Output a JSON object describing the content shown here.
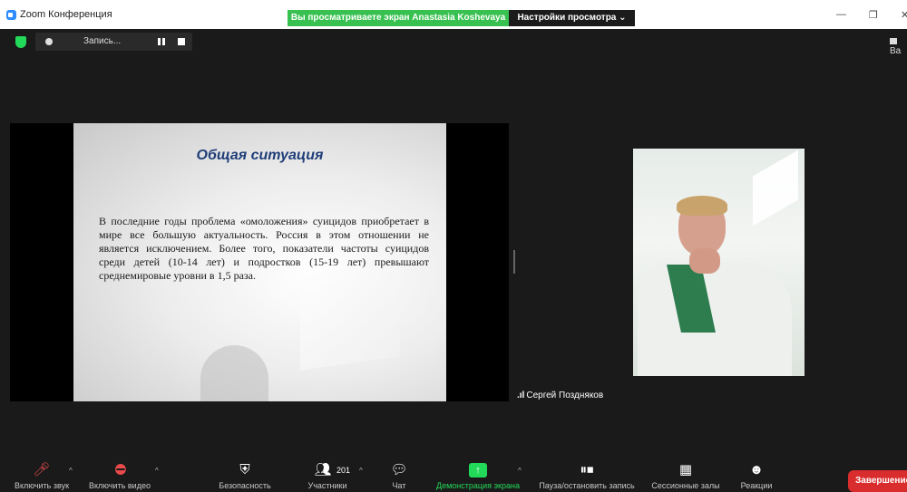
{
  "titlebar": {
    "app_title": "Zoom Конференция",
    "share_banner": "Вы просматриваете экран Anastasia Koshevaya",
    "view_options": "Настройки просмотра ⌄",
    "minimize": "—",
    "restore": "❐",
    "close": "✕"
  },
  "meeting": {
    "recording_label": "Запись...",
    "view_label": "Ва"
  },
  "slide": {
    "title": "Общая ситуация",
    "body": "В последние годы проблема «омоложения» суицидов приобретает в мире все большую актуальность. Россия в этом отношении не является исключением. Более того, показатели частоты суицидов среди детей (10-14 лет) и подростков (15-19 лет) превышают среднемировые уровни в 1,5 раза."
  },
  "video": {
    "participant_name": "Сергей Поздняков",
    "signal_icon": "signal-bars-icon"
  },
  "toolbar": {
    "items": [
      {
        "label": "Включить звук",
        "icon": "mic-muted-icon"
      },
      {
        "label": "Включить видео",
        "icon": "video-off-icon"
      },
      {
        "label": "Безопасность",
        "icon": "shield-icon"
      },
      {
        "label": "Участники",
        "icon": "participants-icon",
        "count": "201"
      },
      {
        "label": "Чат",
        "icon": "chat-icon"
      },
      {
        "label": "Демонстрация экрана",
        "icon": "share-screen-icon"
      },
      {
        "label": "Пауза/остановить запись",
        "icon": "record-control-icon"
      },
      {
        "label": "Сессионные залы",
        "icon": "breakout-rooms-icon"
      },
      {
        "label": "Реакции",
        "icon": "reactions-icon"
      }
    ],
    "end_label": "Завершение"
  },
  "colors": {
    "banner_green": "#38c150",
    "share_green": "#23d959",
    "end_red": "#d92c2c",
    "slide_title_blue": "#1f3d78",
    "background": "#1a1a1a"
  }
}
